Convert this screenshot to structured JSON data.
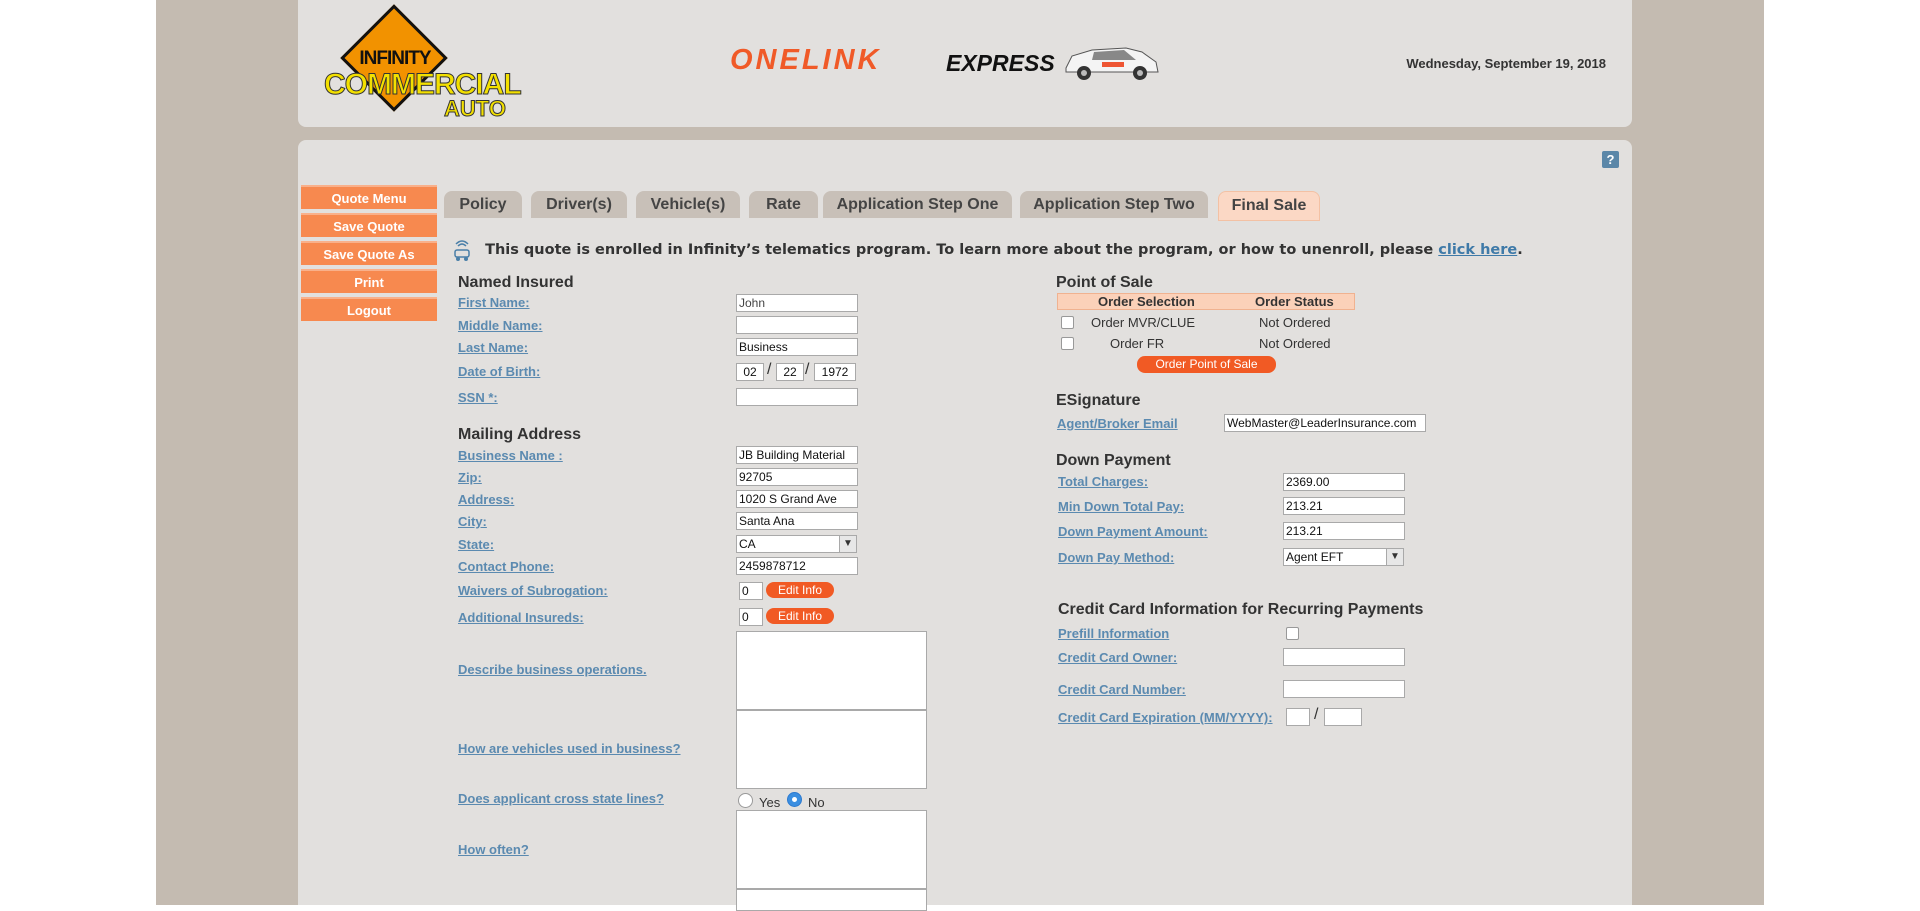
{
  "header": {
    "logo_line1": "INFINITY",
    "logo_line2": "COMMERCIAL",
    "logo_line3": "AUTO",
    "brand_one": "ONELINK",
    "brand_express": "EXPRESS",
    "date": "Wednesday, September 19, 2018"
  },
  "help": "?",
  "side_menu": [
    "Quote Menu",
    "Save Quote",
    "Save Quote As",
    "Print",
    "Logout"
  ],
  "tabs": [
    "Policy",
    "Driver(s)",
    "Vehicle(s)",
    "Rate",
    "Application Step One",
    "Application Step Two",
    "Final Sale"
  ],
  "active_tab": "Final Sale",
  "telematics": {
    "text": "This quote is enrolled in Infinity’s telematics program. To learn more about the program, or how to unenroll, please ",
    "link": "click here",
    "end": "."
  },
  "named_insured": {
    "title": "Named Insured",
    "first_name_label": "First Name:",
    "first_name": "John",
    "middle_name_label": "Middle Name:",
    "middle_name": "",
    "last_name_label": "Last Name:",
    "last_name": "Business",
    "dob_label": "Date of Birth:",
    "dob_month": "02",
    "dob_day": "22",
    "dob_year": "1972",
    "ssn_label": "SSN *:",
    "ssn": ""
  },
  "mailing": {
    "title": "Mailing Address",
    "business_name_label": "Business Name :",
    "business_name": "JB Building Material",
    "zip_label": "Zip:",
    "zip": "92705",
    "address_label": "Address:",
    "address": "1020 S Grand Ave",
    "city_label": "City:",
    "city": "Santa Ana",
    "state_label": "State:",
    "state": "CA",
    "phone_label": "Contact Phone:",
    "phone": "2459878712",
    "waivers_label": "Waivers of Subrogation:",
    "waivers": "0",
    "additional_label": "Additional Insureds:",
    "additional": "0",
    "edit_info": "Edit Info",
    "describe_label": "Describe business operations.",
    "vehicles_label": "How are vehicles used in business?",
    "cross_label": "Does applicant cross state lines?",
    "yes": "Yes",
    "no": "No",
    "cross_value": "No",
    "often_label": "How often?"
  },
  "point_of_sale": {
    "title": "Point of Sale",
    "col_selection": "Order Selection",
    "col_status": "Order Status",
    "rows": [
      {
        "selection": "Order MVR/CLUE",
        "status": "Not Ordered"
      },
      {
        "selection": "Order FR",
        "status": "Not Ordered"
      }
    ],
    "button": "Order Point of Sale"
  },
  "esignature": {
    "title": "ESignature",
    "email_label": "Agent/Broker Email",
    "email": "WebMaster@LeaderInsurance.com"
  },
  "down_payment": {
    "title": "Down Payment",
    "total_label": "Total Charges:",
    "total": "2369.00",
    "min_label": "Min Down Total Pay:",
    "min": "213.21",
    "amount_label": "Down Payment Amount:",
    "amount": "213.21",
    "method_label": "Down Pay Method:",
    "method": "Agent EFT"
  },
  "credit_card": {
    "title": "Credit Card Information for Recurring Payments",
    "prefill_label": "Prefill Information",
    "owner_label": "Credit Card Owner:",
    "number_label": "Credit Card Number:",
    "expiration_label": "Credit Card Expiration (MM/YYYY):"
  },
  "colors": {
    "accent": "#f7894f",
    "button": "#f15a24",
    "link": "#5b8ab0",
    "panel": "#e2e0de",
    "frame": "#c4bbb1"
  }
}
